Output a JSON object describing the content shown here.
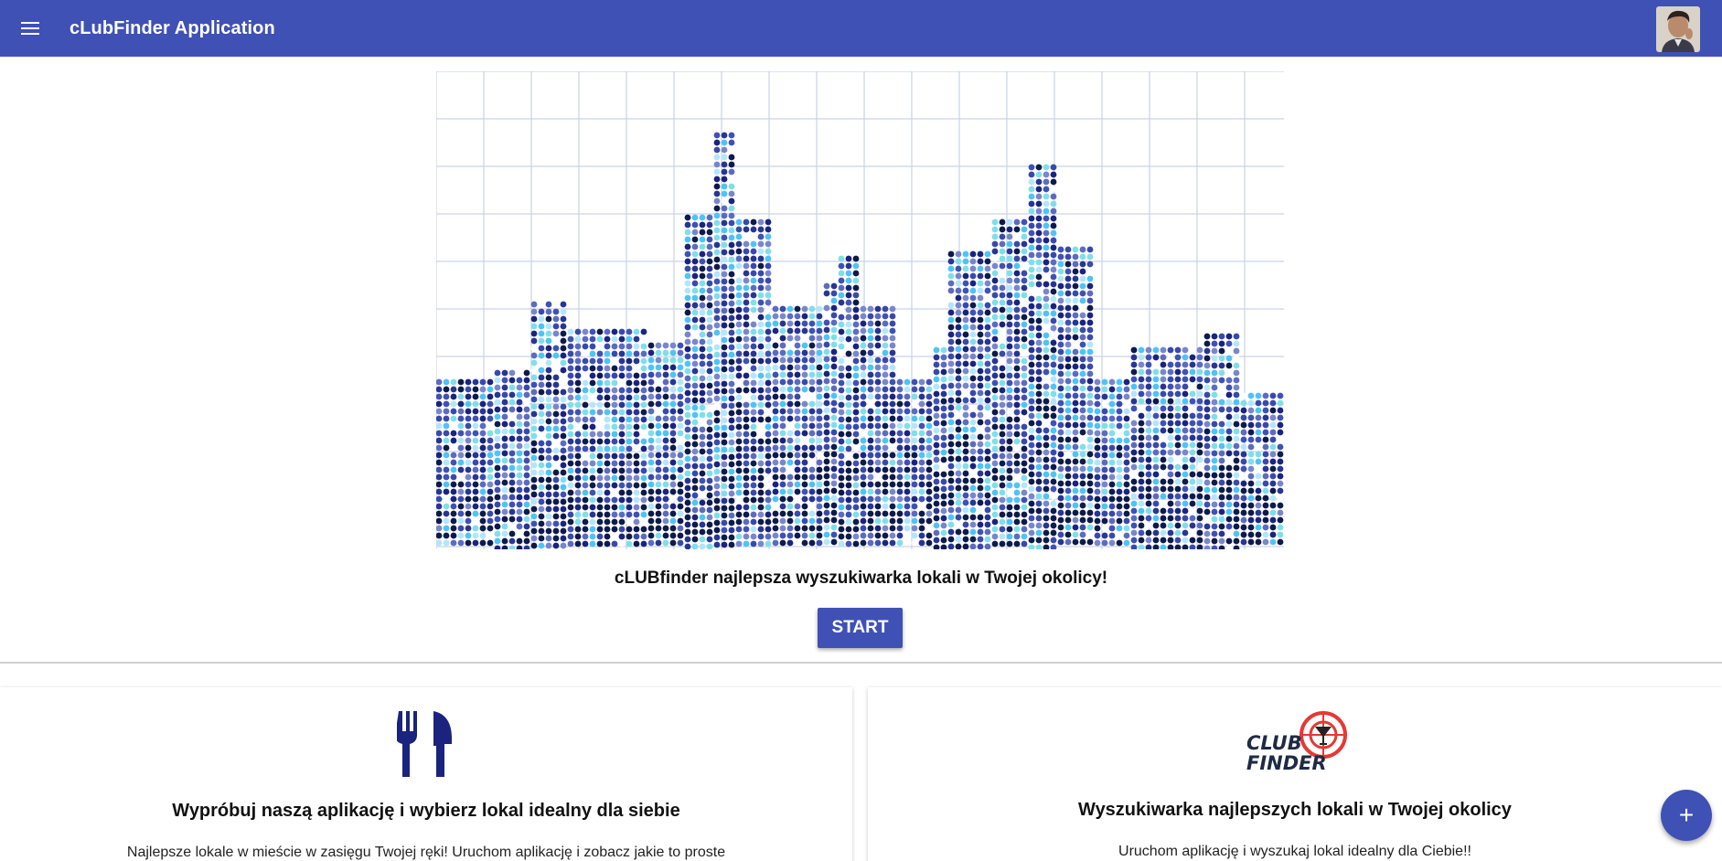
{
  "app": {
    "title": "cLubFinder Application"
  },
  "toolbar": {
    "menu_icon": "menu-icon",
    "avatar": "user-avatar"
  },
  "hero": {
    "image": "city-skyline-illustration"
  },
  "tagline": "cLUBfinder najlepsza wyszukiwarka lokali w Twojej okolicy!",
  "start_button": {
    "label": "START"
  },
  "cards": [
    {
      "icon": "fork-knife-icon",
      "title": "Wypróbuj naszą aplikację i wybierz lokal idealny dla siebie",
      "text": "Najlepsze lokale w mieście w zasięgu Twojej ręki! Uruchom aplikację i zobacz jakie to proste"
    },
    {
      "icon": "club-finder-logo",
      "logo_text": "CLUB FINDER",
      "title": "Wyszukiwarka najlepszych lokali w Twojej okolicy",
      "text": "Uruchom aplikację i wyszukaj lokal idealny dla Ciebie!!"
    }
  ],
  "fab": {
    "icon": "plus-icon",
    "label": "+"
  },
  "colors": {
    "primary": "#3f51b5",
    "icon_navy": "#1a237e",
    "logo_red": "#e53935"
  }
}
